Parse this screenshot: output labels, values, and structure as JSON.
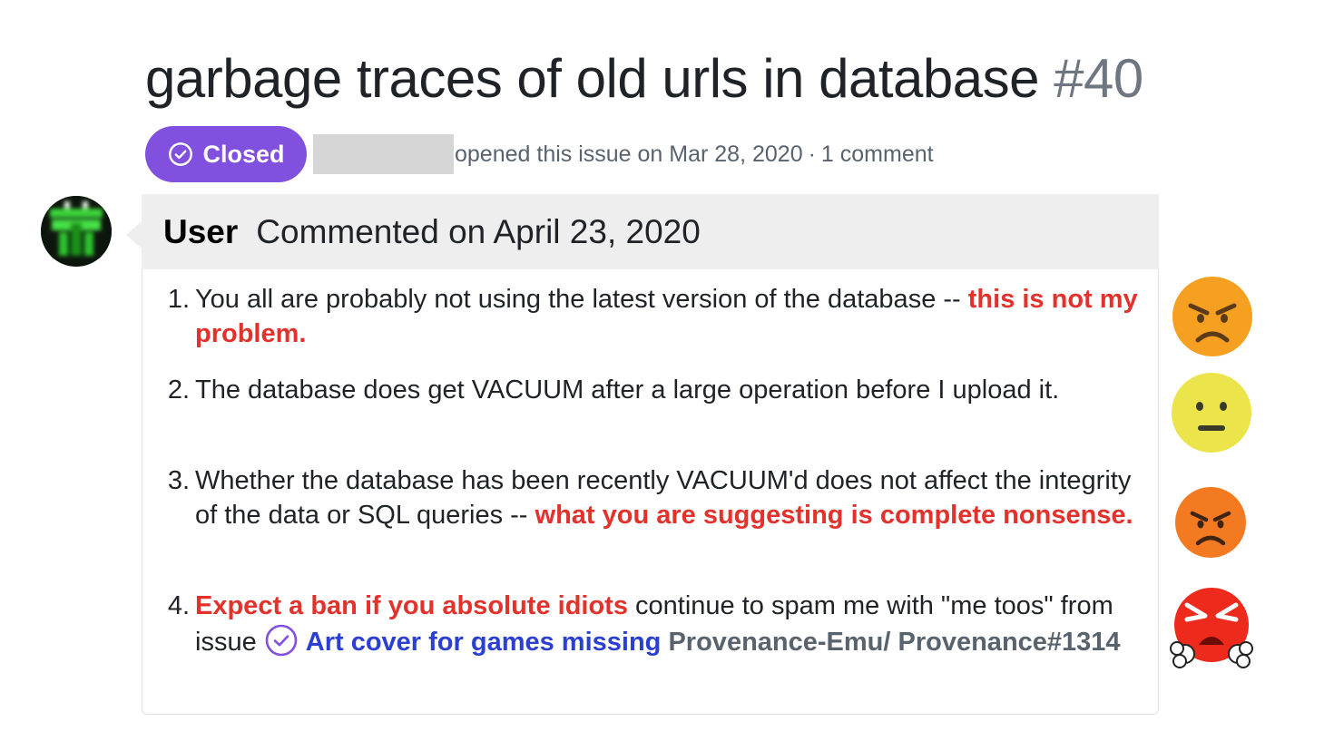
{
  "issue": {
    "title": "garbage traces of old urls in database",
    "number": "#40",
    "state": "Closed",
    "meta_text": "opened this issue on Mar 28, 2020",
    "meta_sep": "·",
    "meta_comments": "1 comment"
  },
  "comment": {
    "author": "User",
    "date_text": "Commented on April 23, 2020",
    "items": [
      {
        "number": "1.",
        "text_plain": "You all are probably not using the latest version of the database --",
        "text_emph": "this is not my problem."
      },
      {
        "number": "2.",
        "text_plain": "The database does get VACUUM after a large operation before I upload it."
      },
      {
        "number": "3.",
        "text_plain": "Whether the database has been recently VACUUM'd does not affect the integrity of the data or SQL queries --",
        "text_emph": "what you are suggesting is complete nonsense."
      },
      {
        "number": "4.",
        "text_emph": "Expect a ban if you absolute idiots",
        "text_plain": "continue to spam me with \"me toos\" from issue",
        "link_text": "Art cover for games missing",
        "repo_ref": "Provenance-Emu/ Provenance#1314"
      }
    ]
  },
  "reactions": [
    {
      "icon": "angry-face-icon",
      "color": "#f5a020"
    },
    {
      "icon": "neutral-face-icon",
      "color": "#f0e34a"
    },
    {
      "icon": "angry-face-icon",
      "color": "#f47a22"
    },
    {
      "icon": "furious-face-icon",
      "color": "#ee2a1c"
    }
  ],
  "colors": {
    "closed_badge": "#8250df",
    "emphasis_red": "#e3312b",
    "link_blue": "#2b3fd1"
  }
}
